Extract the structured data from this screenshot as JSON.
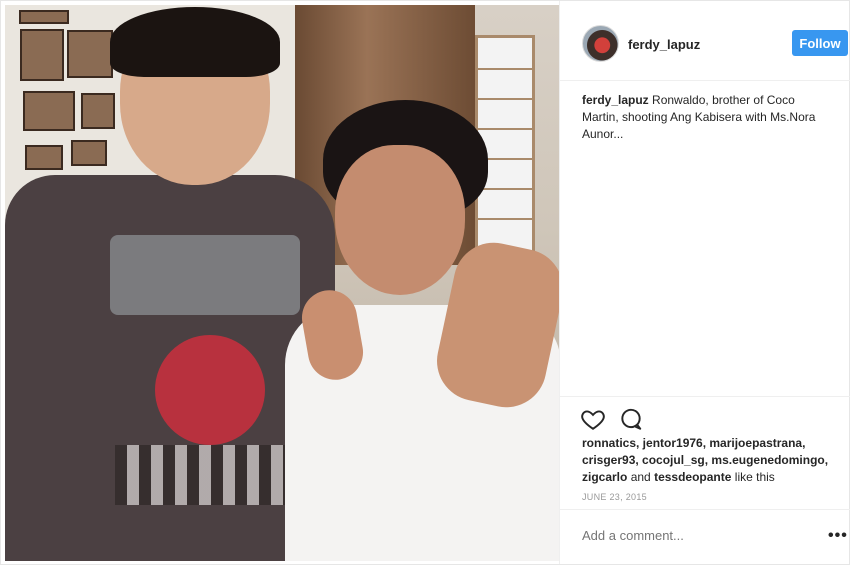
{
  "post": {
    "image_alt": "",
    "author": {
      "username": "ferdy_lapuz"
    },
    "follow_label": "Follow",
    "caption": {
      "username": "ferdy_lapuz",
      "text": "Ronwaldo, brother of Coco Martin, shooting Ang Kabisera with Ms.Nora Aunor..."
    },
    "actions": {
      "like_icon": "heart-icon",
      "comment_icon": "comment-icon"
    },
    "likes": {
      "names": "ronnatics, jentor1976, marijoepastrana, crisger93, cocojul_sg, ms.eugenedomingo, zigcarlo",
      "joiner": "and",
      "last": "tessdeopante",
      "suffix": "like this"
    },
    "date": "JUNE 23, 2015",
    "comment_placeholder": "Add a comment...",
    "more_label": "•••"
  },
  "colors": {
    "accent": "#3897f0",
    "text": "#262626",
    "muted": "#999999"
  }
}
